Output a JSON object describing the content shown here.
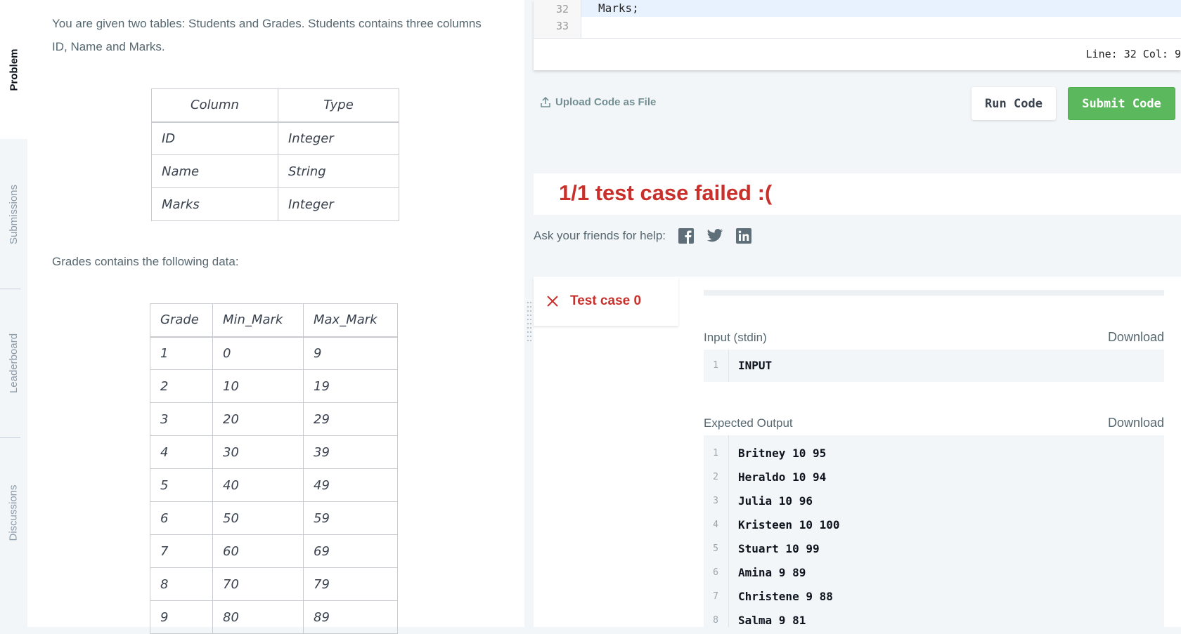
{
  "tabs": [
    "Problem",
    "Submissions",
    "Leaderboard",
    "Discussions"
  ],
  "problem": {
    "intro_line1": "You are given two tables: Students and Grades. Students contains three columns",
    "intro_line2": "ID, Name and Marks.",
    "students_table": {
      "headers": [
        "Column",
        "Type"
      ],
      "rows": [
        [
          "ID",
          "Integer"
        ],
        [
          "Name",
          "String"
        ],
        [
          "Marks",
          "Integer"
        ]
      ]
    },
    "grades_intro": "Grades contains the following data:",
    "grades_table": {
      "headers": [
        "Grade",
        "Min_Mark",
        "Max_Mark"
      ],
      "rows": [
        [
          "1",
          "0",
          "9"
        ],
        [
          "2",
          "10",
          "19"
        ],
        [
          "3",
          "20",
          "29"
        ],
        [
          "4",
          "30",
          "39"
        ],
        [
          "5",
          "40",
          "49"
        ],
        [
          "6",
          "50",
          "59"
        ],
        [
          "7",
          "60",
          "69"
        ],
        [
          "8",
          "70",
          "79"
        ],
        [
          "9",
          "80",
          "89"
        ]
      ]
    }
  },
  "editor": {
    "lines": [
      {
        "num": "32",
        "text": "Marks;"
      },
      {
        "num": "33",
        "text": ""
      }
    ],
    "status": "Line: 32 Col: 9"
  },
  "actions": {
    "upload": "Upload Code as File",
    "run": "Run Code",
    "submit": "Submit Code"
  },
  "result": {
    "title": "1/1 test case failed :(",
    "ask": "Ask your friends for help:"
  },
  "testcase": {
    "tab_label": "Test case 0",
    "input_label": "Input (stdin)",
    "download": "Download",
    "input_lines": [
      "INPUT"
    ],
    "expected_label": "Expected Output",
    "expected_lines": [
      "Britney 10 95",
      "Heraldo 10 94",
      "Julia 10 96",
      "Kristeen 10 100",
      "Stuart 10 99",
      "Amina 9 89",
      "Christene 9 88",
      "Salma 9 81"
    ]
  },
  "colors": {
    "fail_red": "#c9302c",
    "submit_green": "#5cb85c"
  },
  "icons": [
    "upload-icon",
    "facebook-icon",
    "twitter-icon",
    "linkedin-icon",
    "close-x-icon"
  ]
}
